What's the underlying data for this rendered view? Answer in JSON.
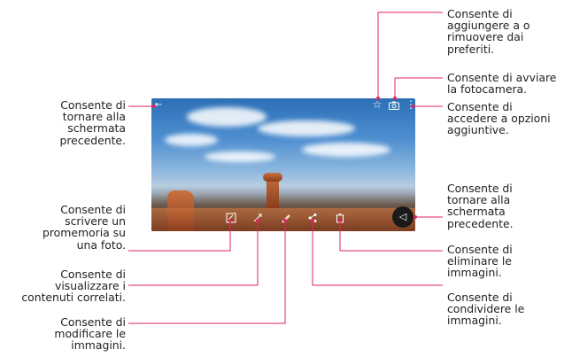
{
  "labels": {
    "favorite": "Consente di\naggiungere a o\nrimuovere dai\npreferiti.",
    "camera": "Consente di avviare\nla fotocamera.",
    "options": "Consente di\naccedere a opzioni\naggiuntive.",
    "back_top": "Consente di\ntornare alla\nschermata\nprecedente.",
    "back_right": "Consente di\ntornare alla\nschermata\nprecedente.",
    "memo": "Consente di\nscrivere un\npromemoria su\nuna foto.",
    "related": "Consente di\nvisualizzare i\ncontenuti correlati.",
    "edit": "Consente di\nmodificare le\nimmagini.",
    "delete": "Consente di\neliminare le\nimmagini.",
    "share": "Consente di\ncondividere le\nimmagini."
  },
  "colors": {
    "leader_line": "#e0245e",
    "text": "#222222"
  },
  "icons": {
    "back": "arrow-left-icon",
    "favorite": "star-icon",
    "camera": "camera-icon",
    "more": "more-vertical-icon",
    "memo": "memo-icon",
    "related": "related-content-icon",
    "edit": "pencil-icon",
    "share": "share-icon",
    "delete": "trash-icon",
    "nav_back": "triangle-back-icon"
  }
}
